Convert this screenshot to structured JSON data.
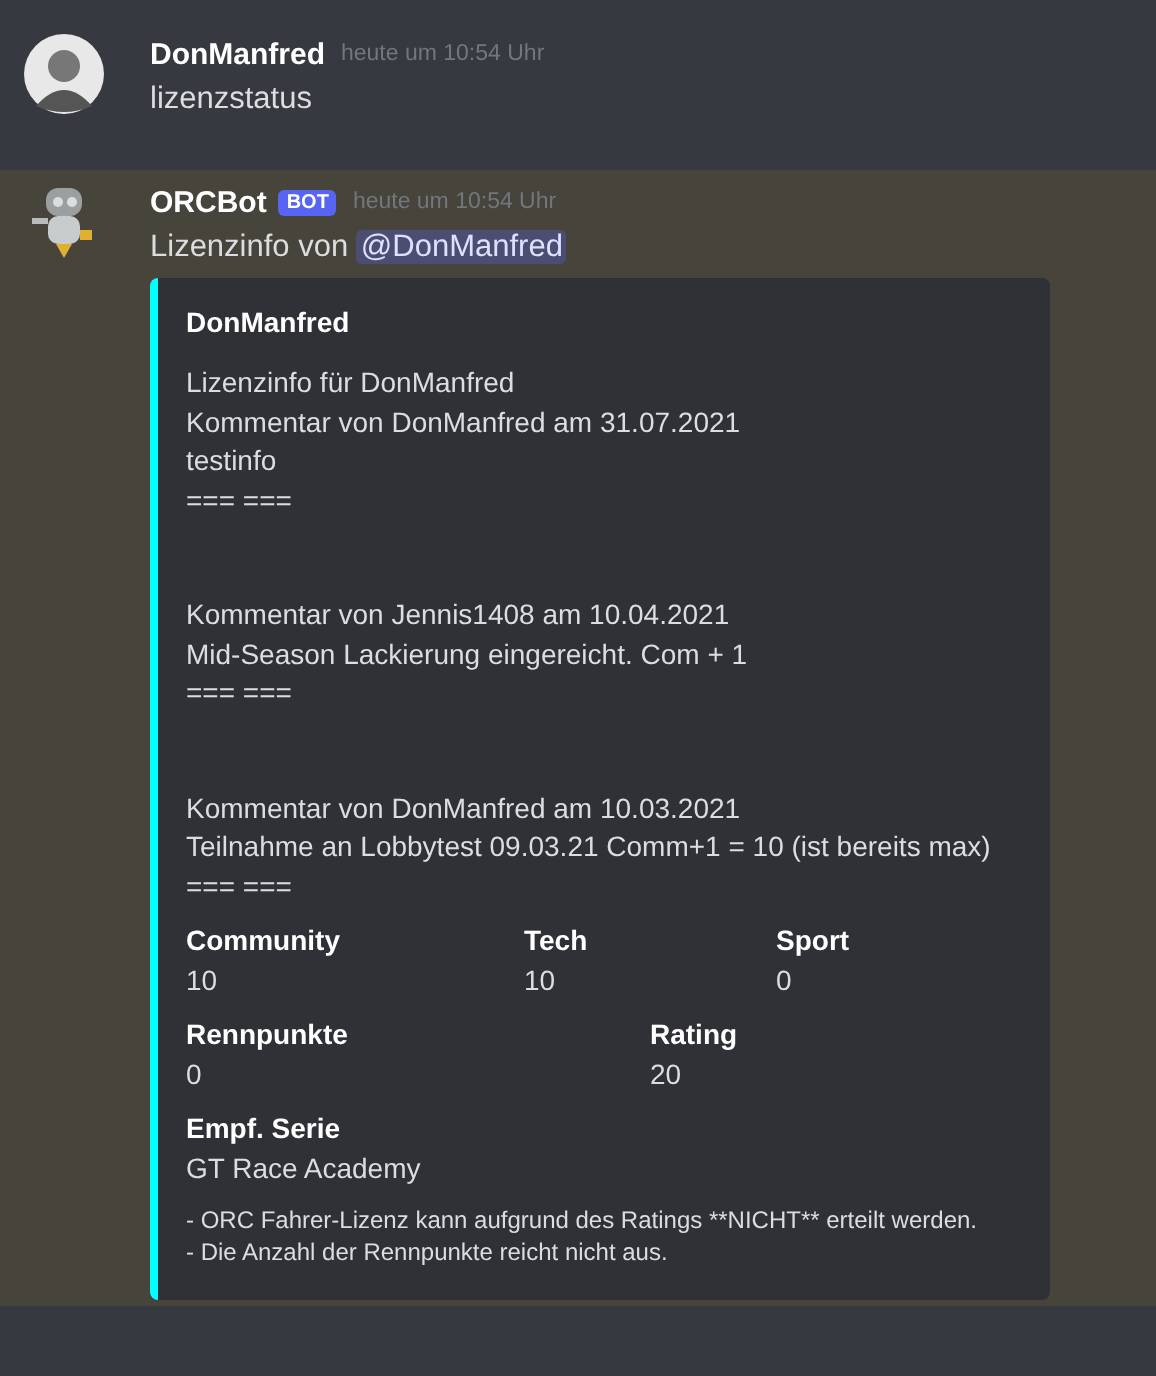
{
  "messages": [
    {
      "author": "DonManfred",
      "avatar": {
        "kind": "person"
      },
      "timestamp": "heute um 10:54 Uhr",
      "hovered": false,
      "content": [
        {
          "kind": "text",
          "text": "lizenzstatus"
        }
      ]
    },
    {
      "author": "ORCBot",
      "avatar": {
        "kind": "robot"
      },
      "bot_badge": "BOT",
      "timestamp": "heute um 10:54 Uhr",
      "hovered": true,
      "content": [
        {
          "kind": "text",
          "text": "Lizenzinfo von "
        },
        {
          "kind": "mention",
          "text": "@DonManfred"
        }
      ],
      "embed": {
        "color": "#00ffff",
        "title": "DonManfred",
        "description": [
          [
            "Lizenzinfo für DonManfred",
            "Kommentar von DonManfred am 31.07.2021",
            "testinfo",
            "=== ==="
          ],
          [
            "Kommentar von Jennis1408 am 10.04.2021",
            "Mid-Season Lackierung eingereicht. Com + 1",
            "=== ==="
          ],
          [
            "Kommentar von DonManfred am 10.03.2021",
            "Teilnahme an Lobbytest 09.03.21 Comm+1 = 10 (ist bereits max)",
            "=== ==="
          ]
        ],
        "field_rows": [
          [
            {
              "name": "Community",
              "value": "10"
            },
            {
              "name": "Tech",
              "value": "10"
            },
            {
              "name": "Sport",
              "value": "0"
            }
          ],
          [
            {
              "name": "Rennpunkte",
              "value": "0"
            },
            {
              "name": "Rating",
              "value": "20"
            }
          ],
          [
            {
              "name": "Empf. Serie",
              "value": "GT Race Academy"
            }
          ]
        ],
        "footer": [
          "- ORC Fahrer-Lizenz kann aufgrund des Ratings **NICHT** erteilt werden.",
          "- Die Anzahl der Rennpunkte reicht nicht aus."
        ]
      }
    }
  ]
}
